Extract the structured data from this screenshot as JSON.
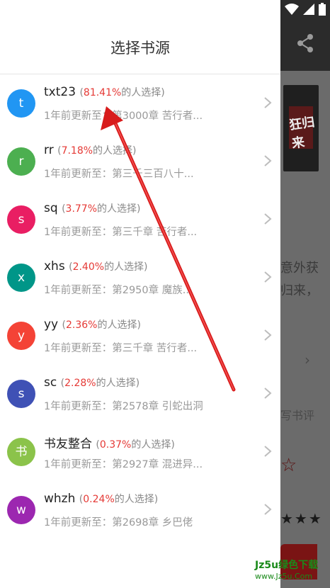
{
  "drawer": {
    "title": "选择书源",
    "sources": [
      {
        "avatar_letter": "t",
        "avatar_color": "#2196F3",
        "name": "txt23",
        "open_paren": "(",
        "percent": "81.41%",
        "suffix": "的人选择)",
        "update": "1年前更新至：第3000章 苦行者..."
      },
      {
        "avatar_letter": "r",
        "avatar_color": "#4CAF50",
        "name": "rr",
        "open_paren": "(",
        "percent": "7.18%",
        "suffix": "的人选择)",
        "update": "1年前更新至：第三千三百八十..."
      },
      {
        "avatar_letter": "s",
        "avatar_color": "#E91E63",
        "name": "sq",
        "open_paren": "(",
        "percent": "3.77%",
        "suffix": "的人选择)",
        "update": "1年前更新至：第三千章 苦行者..."
      },
      {
        "avatar_letter": "x",
        "avatar_color": "#009688",
        "name": "xhs",
        "open_paren": "(",
        "percent": "2.40%",
        "suffix": "的人选择)",
        "update": "1年前更新至：第2950章 魔族..."
      },
      {
        "avatar_letter": "y",
        "avatar_color": "#F44336",
        "name": "yy",
        "open_paren": "(",
        "percent": "2.36%",
        "suffix": "的人选择)",
        "update": "1年前更新至：第三千章 苦行者..."
      },
      {
        "avatar_letter": "s",
        "avatar_color": "#3F51B5",
        "name": "sc",
        "open_paren": "(",
        "percent": "2.28%",
        "suffix": "的人选择)",
        "update": "1年前更新至：第2578章 引蛇出洞"
      },
      {
        "avatar_letter": "书",
        "avatar_color": "#8BC34A",
        "name": "书友整合",
        "open_paren": "(",
        "percent": "0.37%",
        "suffix": "的人选择)",
        "update": "1年前更新至：第2927章 混进异..."
      },
      {
        "avatar_letter": "w",
        "avatar_color": "#9C27B0",
        "name": "whzh",
        "open_paren": "(",
        "percent": "0.24%",
        "suffix": "的人选择)",
        "update": "1年前更新至：第2698章 乡巴佬"
      }
    ]
  },
  "background": {
    "cover_text": "狂归来",
    "text_line_1": "意外获",
    "text_line_2": "归来，",
    "review_label": "写书评",
    "stars": "★★★",
    "star_outline": "☆"
  },
  "watermark": {
    "line1": "Jz5u绿色下载",
    "line2": "www.Jz5u.Com"
  },
  "colors": {
    "accent_red": "#e53935",
    "arrow_red": "#d81b1b"
  }
}
